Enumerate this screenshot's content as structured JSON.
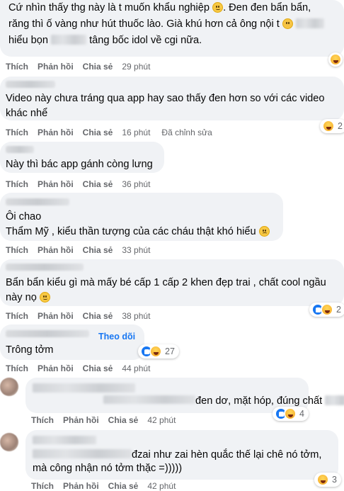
{
  "actions": {
    "like": "Thích",
    "reply": "Phản hồi",
    "share": "Chia sẻ"
  },
  "edited_label": "Đã chỉnh sửa",
  "follow_label": "Theo dõi",
  "comments": [
    {
      "line1": "Cứ nhìn thấy thg này là t muốn khẩu nghiệp",
      "line1_after": ". Đen đen bẩn bẩn,",
      "line2": "răng thì ố vàng như hút thuốc lào. Già khú hơn cả ông nội t",
      "line3_a": "hiểu bọn",
      "line3_b": "tâng bốc idol về cgi nữa.",
      "time": "29 phút"
    },
    {
      "line1": "Video này chưa tráng qua app hay sao thấy đen hơn so với các video",
      "line2": "khác nhể",
      "time": "16 phút",
      "reaction_count": "2"
    },
    {
      "line1": "Này thì bác app gánh còng lưng",
      "time": "36 phút"
    },
    {
      "line1": "Ôi chao",
      "line2": "Thẩm Mỹ , kiểu thần tượng của các cháu thật khó hiểu",
      "time": "33 phút"
    },
    {
      "line1": "Bẩn bẩn kiểu gì mà mấy bé cấp 1 cấp 2 khen đẹp trai , chất cool ngầu",
      "line2": "này nọ",
      "time": "38 phút",
      "reaction_count": "2"
    },
    {
      "line1": "Trông tởm",
      "time": "44 phút",
      "reaction_count": "27"
    },
    {
      "line1": "đen dơ, mặt hóp, đúng chất",
      "time": "42 phút",
      "reaction_count": "4"
    },
    {
      "line1": "đzai như zai hèn quắc thế lại chê nó tởm,",
      "line2": "mà công nhận nó tởm thặc =)))))",
      "time": "42 phút",
      "reaction_count": "3"
    }
  ]
}
